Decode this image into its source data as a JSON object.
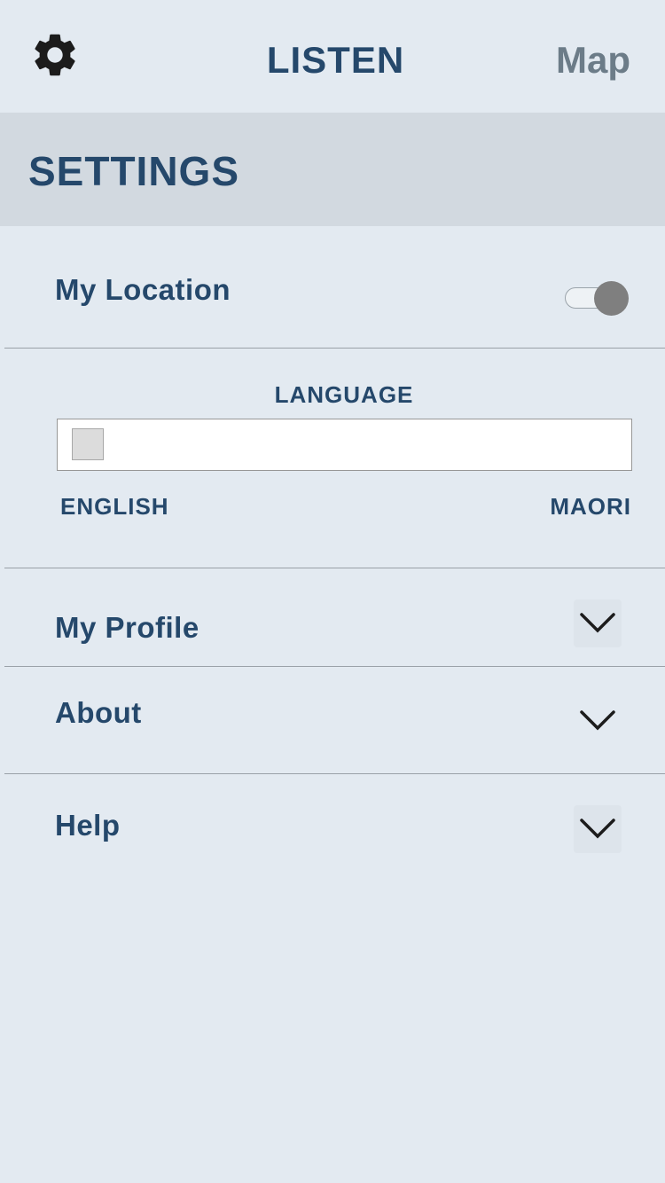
{
  "header": {
    "title": "LISTEN",
    "map_label": "Map",
    "settings_icon": "gear-icon"
  },
  "settings": {
    "title": "SETTINGS"
  },
  "location": {
    "label": "My Location",
    "toggle_on": true
  },
  "language": {
    "heading": "LANGUAGE",
    "left_option": "ENGLISH",
    "right_option": "MAORI",
    "slider_value": 0
  },
  "sections": [
    {
      "label": "My Profile",
      "icon": "chevron-down-icon"
    },
    {
      "label": "About",
      "icon": "chevron-down-icon"
    },
    {
      "label": "Help",
      "icon": "chevron-down-icon"
    }
  ],
  "colors": {
    "background": "#e3eaf1",
    "band": "#d2d9e0",
    "text": "#25486b",
    "muted": "#6c7c88"
  }
}
